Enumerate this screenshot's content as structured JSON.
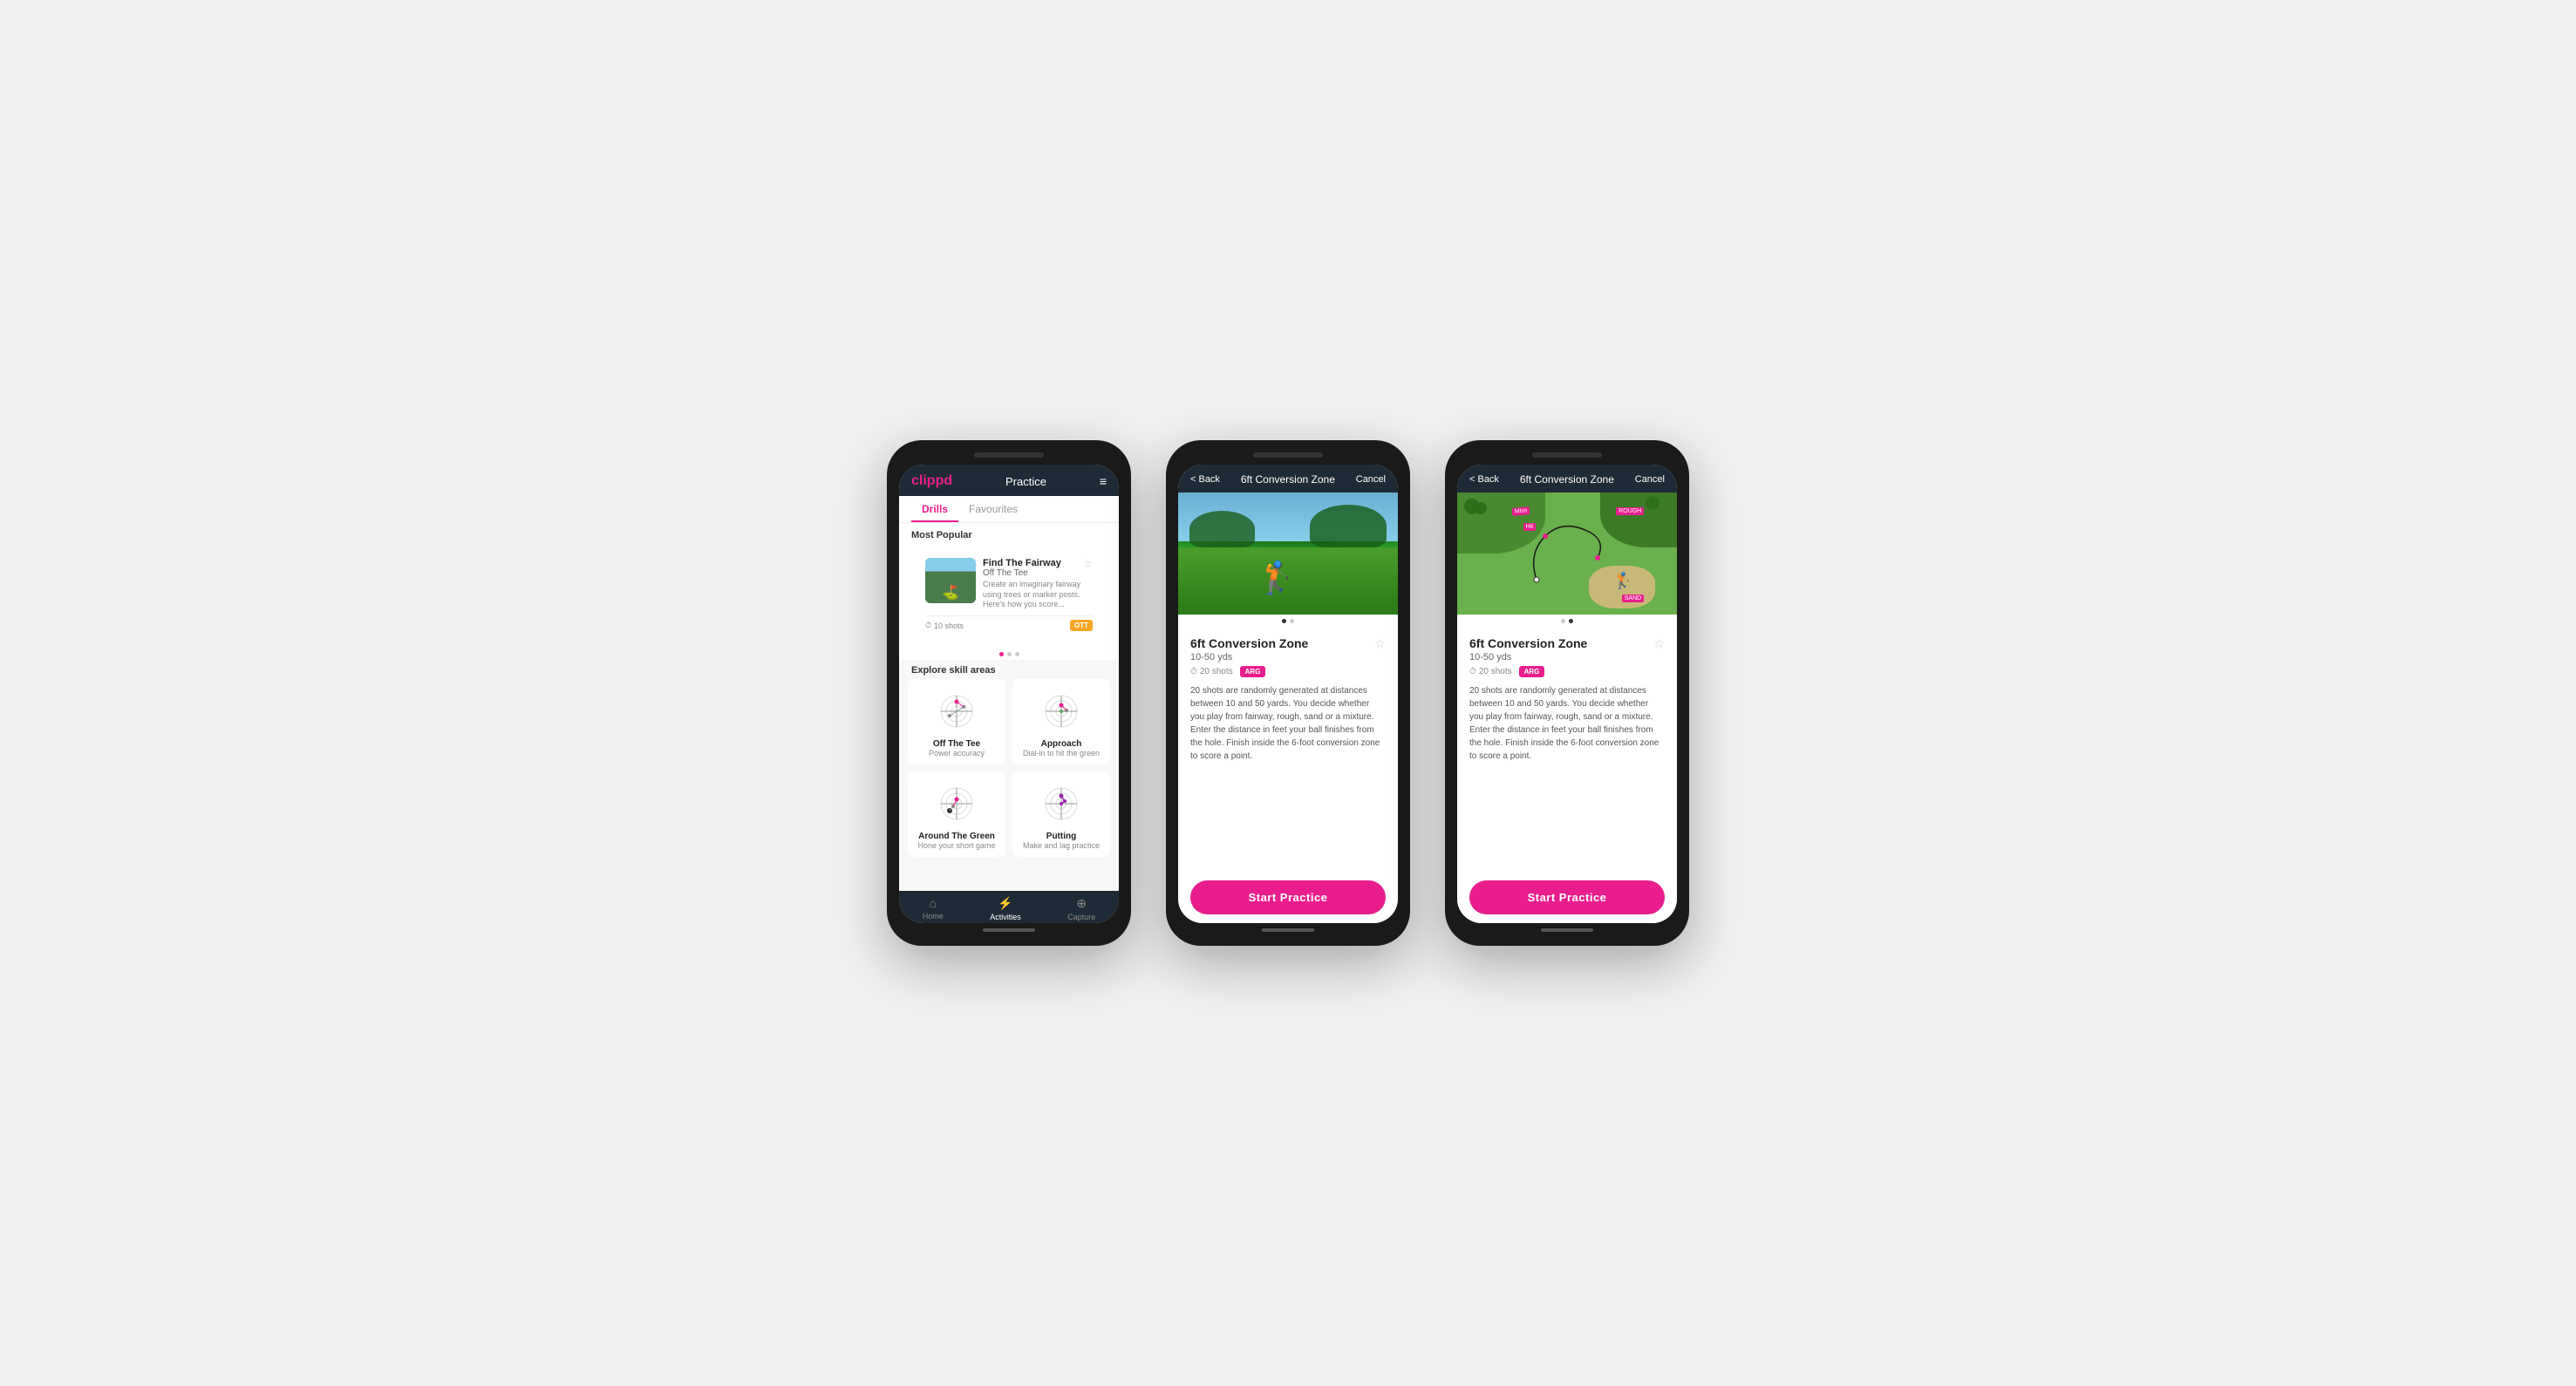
{
  "phone1": {
    "header": {
      "logo": "clippd",
      "title": "Practice",
      "menu_icon": "≡"
    },
    "tabs": [
      {
        "label": "Drills",
        "active": true
      },
      {
        "label": "Favourites",
        "active": false
      }
    ],
    "most_popular_label": "Most Popular",
    "featured_card": {
      "title": "Find The Fairway",
      "subtitle": "Off The Tee",
      "description": "Create an imaginary fairway using trees or marker posts. Here's how you score...",
      "shots": "10 shots",
      "badge": "OTT"
    },
    "explore_label": "Explore skill areas",
    "skill_areas": [
      {
        "name": "Off The Tee",
        "sub": "Power accuracy"
      },
      {
        "name": "Approach",
        "sub": "Dial-in to hit the green"
      },
      {
        "name": "Around The Green",
        "sub": "Hone your short game"
      },
      {
        "name": "Putting",
        "sub": "Make and lag practice"
      }
    ],
    "bottom_nav": [
      {
        "label": "Home",
        "icon": "⌂",
        "active": false
      },
      {
        "label": "Activities",
        "icon": "⚡",
        "active": true
      },
      {
        "label": "Capture",
        "icon": "⊕",
        "active": false
      }
    ]
  },
  "phone2": {
    "header": {
      "back_label": "< Back",
      "title": "6ft Conversion Zone",
      "cancel_label": "Cancel"
    },
    "drill": {
      "title": "6ft Conversion Zone",
      "range": "10-50 yds",
      "shots": "20 shots",
      "badge": "ARG",
      "description": "20 shots are randomly generated at distances between 10 and 50 yards. You decide whether you play from fairway, rough, sand or a mixture. Enter the distance in feet your ball finishes from the hole. Finish inside the 6-foot conversion zone to score a point."
    },
    "start_btn": "Start Practice"
  },
  "phone3": {
    "header": {
      "back_label": "< Back",
      "title": "6ft Conversion Zone",
      "cancel_label": "Cancel"
    },
    "drill": {
      "title": "6ft Conversion Zone",
      "range": "10-50 yds",
      "shots": "20 shots",
      "badge": "ARG",
      "description": "20 shots are randomly generated at distances between 10 and 50 yards. You decide whether you play from fairway, rough, sand or a mixture. Enter the distance in feet your ball finishes from the hole. Finish inside the 6-foot conversion zone to score a point."
    },
    "start_btn": "Start Practice"
  }
}
